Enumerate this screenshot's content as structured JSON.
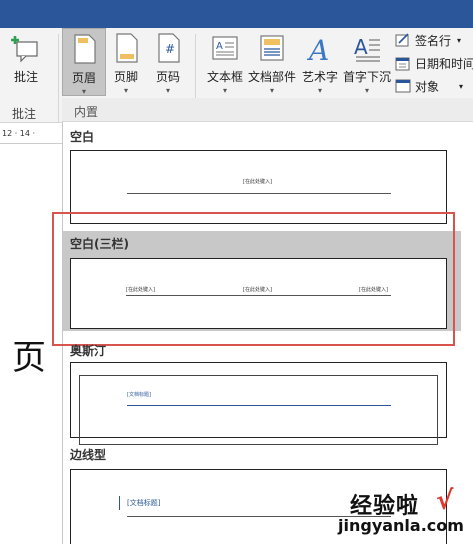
{
  "ribbon": {
    "buttons": [
      {
        "label": "批注",
        "icon": "add-comment-icon",
        "arrow": ""
      },
      {
        "label": "页眉",
        "icon": "header-icon",
        "arrow": "▾"
      },
      {
        "label": "页脚",
        "icon": "footer-icon",
        "arrow": "▾"
      },
      {
        "label": "页码",
        "icon": "page-number-icon",
        "arrow": "▾"
      },
      {
        "label": "文本框",
        "icon": "textbox-icon",
        "arrow": "▾"
      },
      {
        "label": "文档部件",
        "icon": "quick-parts-icon",
        "arrow": "▾"
      },
      {
        "label": "艺术字",
        "icon": "wordart-icon",
        "arrow": "▾"
      },
      {
        "label": "首字下沉",
        "icon": "drop-cap-icon",
        "arrow": "▾"
      }
    ],
    "small_buttons": [
      {
        "label": "签名行",
        "arrow": "▾"
      },
      {
        "label": "日期和时间"
      },
      {
        "label": "对象",
        "arrow": "▾"
      }
    ],
    "group_label_comments": "批注",
    "accent_color": "#2b579a"
  },
  "ruler": {
    "marks": "12  ·  14 ·"
  },
  "document": {
    "visible_text": "页"
  },
  "dropdown": {
    "section_label": "内置",
    "items": [
      {
        "title": "空白",
        "placeholders": [
          "[在此处键入]"
        ]
      },
      {
        "title": "空白(三栏)",
        "placeholders": [
          "[在此处键入]",
          "[在此处键入]",
          "[在此处键入]"
        ]
      },
      {
        "title": "奥斯汀",
        "placeholders": [
          "[文档标题]"
        ]
      },
      {
        "title": "边线型",
        "placeholders": [
          "[文档标题]"
        ]
      }
    ]
  },
  "watermark": {
    "text": "经验啦",
    "sub": "jingyanla.com",
    "check": "√"
  }
}
